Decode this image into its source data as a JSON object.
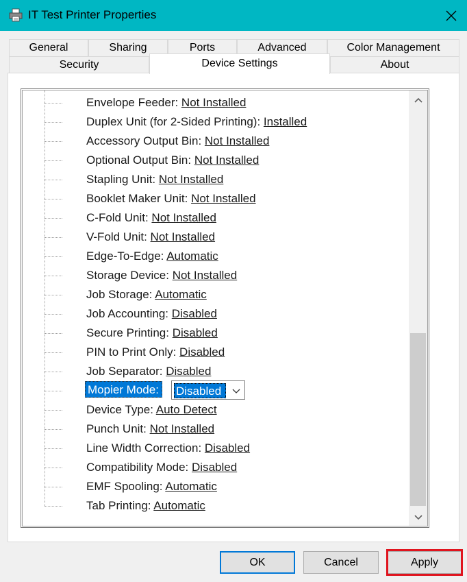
{
  "window": {
    "title": "IT Test Printer Properties",
    "icon": "printer-icon",
    "accent_color": "#00b7c3"
  },
  "tabs_row1": [
    {
      "label": "General"
    },
    {
      "label": "Sharing"
    },
    {
      "label": "Ports"
    },
    {
      "label": "Advanced"
    },
    {
      "label": "Color Management"
    }
  ],
  "tabs_row2": [
    {
      "label": "Security"
    },
    {
      "label": "Device Settings",
      "active": true
    },
    {
      "label": "About"
    }
  ],
  "tree": {
    "items": [
      {
        "label": "Envelope Feeder: ",
        "value": "Not Installed"
      },
      {
        "label": "Duplex Unit (for 2-Sided Printing): ",
        "value": "Installed"
      },
      {
        "label": "Accessory Output Bin: ",
        "value": "Not Installed"
      },
      {
        "label": "Optional Output Bin: ",
        "value": "Not Installed"
      },
      {
        "label": "Stapling Unit: ",
        "value": "Not Installed"
      },
      {
        "label": "Booklet Maker Unit: ",
        "value": "Not Installed"
      },
      {
        "label": "C-Fold Unit: ",
        "value": "Not Installed"
      },
      {
        "label": "V-Fold Unit: ",
        "value": "Not Installed"
      },
      {
        "label": "Edge-To-Edge: ",
        "value": "Automatic"
      },
      {
        "label": "Storage Device: ",
        "value": "Not Installed"
      },
      {
        "label": "Job Storage: ",
        "value": "Automatic"
      },
      {
        "label": "Job Accounting: ",
        "value": "Disabled"
      },
      {
        "label": "Secure Printing: ",
        "value": "Disabled"
      },
      {
        "label": "PIN to Print Only: ",
        "value": "Disabled"
      },
      {
        "label": "Job Separator: ",
        "value": "Disabled"
      },
      {
        "label": "Mopier Mode:",
        "value": "Disabled",
        "selected": true
      },
      {
        "label": "Device Type: ",
        "value": "Auto Detect"
      },
      {
        "label": "Punch Unit: ",
        "value": "Not Installed"
      },
      {
        "label": "Line Width Correction: ",
        "value": "Disabled"
      },
      {
        "label": "Compatibility Mode: ",
        "value": "Disabled"
      },
      {
        "label": "EMF Spooling: ",
        "value": "Automatic"
      },
      {
        "label": "Tab Printing: ",
        "value": "Automatic"
      }
    ]
  },
  "buttons": {
    "ok": "OK",
    "cancel": "Cancel",
    "apply": "Apply"
  },
  "highlight_color": "#e0141e"
}
